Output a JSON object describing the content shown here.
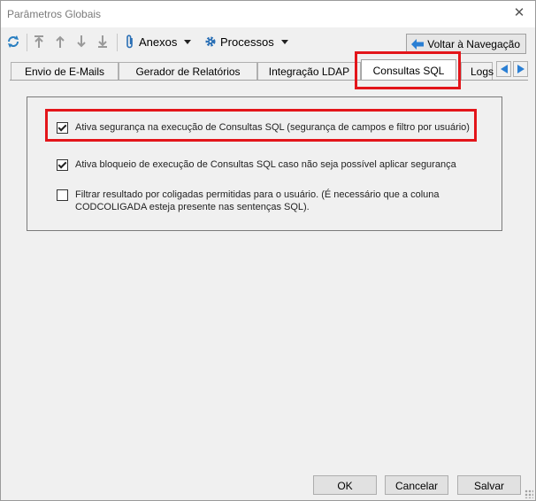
{
  "window": {
    "title": "Parâmetros Globais"
  },
  "toolbar": {
    "anexos_label": "Anexos",
    "processos_label": "Processos",
    "back_label": "Voltar à Navegação"
  },
  "tabs": [
    {
      "label": "Envio de E-Mails",
      "active": false
    },
    {
      "label": "Gerador de Relatórios",
      "active": false
    },
    {
      "label": "Integração LDAP",
      "active": false
    },
    {
      "label": "Consultas SQL",
      "active": true
    },
    {
      "label": "Logs",
      "active": false
    }
  ],
  "options": [
    {
      "label": "Ativa segurança na execução de Consultas SQL (segurança de campos e filtro por usuário)",
      "checked": true
    },
    {
      "label": "Ativa bloqueio de execução de Consultas SQL caso não seja possível aplicar segurança",
      "checked": true
    },
    {
      "label": "Filtrar resultado por coligadas permitidas para o usuário. (É necessário que a coluna",
      "label2": "CODCOLIGADA esteja presente nas sentenças SQL).",
      "checked": false
    }
  ],
  "footer": {
    "ok": "OK",
    "cancel": "Cancelar",
    "save": "Salvar"
  },
  "colors": {
    "highlight": "#e3151a",
    "accent_blue": "#1f6fd1"
  }
}
